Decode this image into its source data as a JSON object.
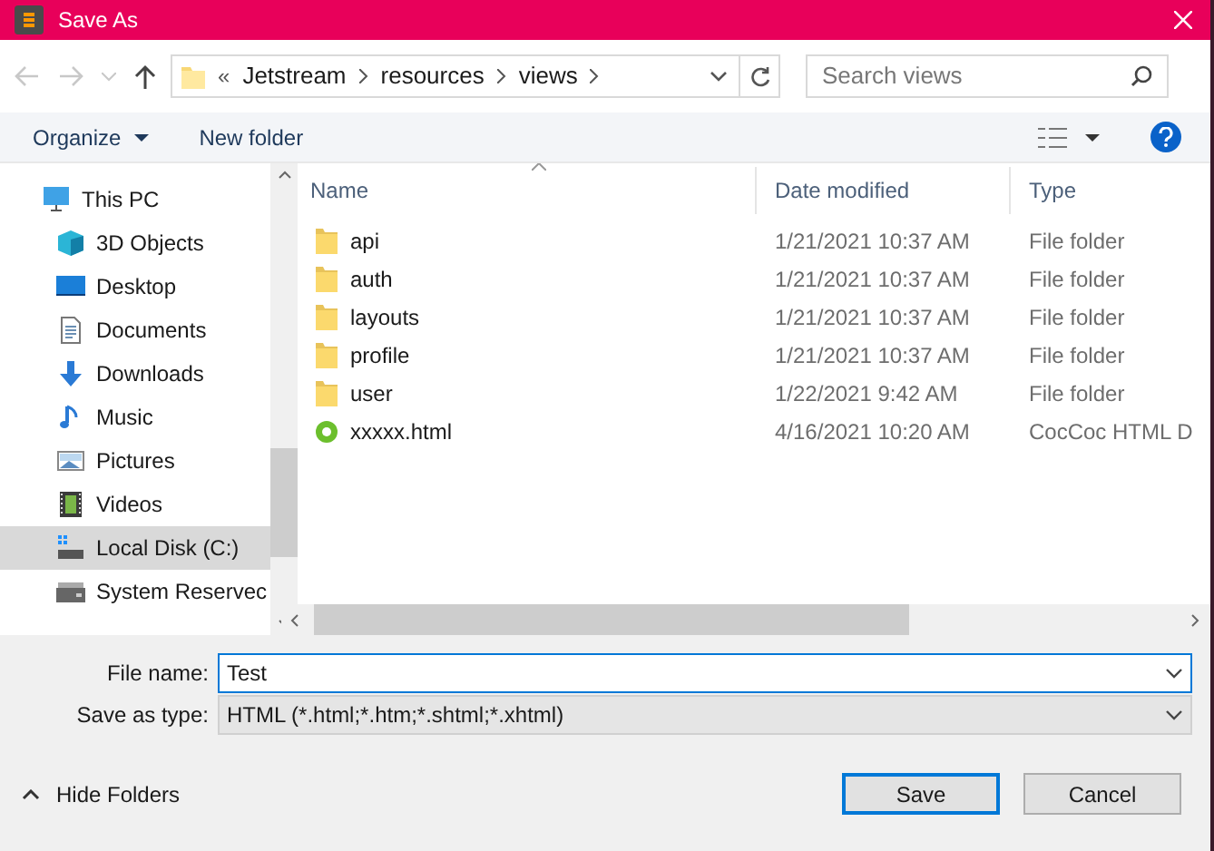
{
  "window": {
    "title": "Save As"
  },
  "address_bar": {
    "overflow": "«",
    "path": [
      "Jetstream",
      "resources",
      "views"
    ]
  },
  "search": {
    "placeholder": "Search views"
  },
  "toolbar": {
    "organize": "Organize",
    "new_folder": "New folder"
  },
  "sidebar": {
    "items": [
      {
        "label": "This PC",
        "kind": "pc",
        "selected": false,
        "children": [
          {
            "label": "3D Objects",
            "kind": "cube",
            "selected": false
          },
          {
            "label": "Desktop",
            "kind": "desktop",
            "selected": false
          },
          {
            "label": "Documents",
            "kind": "document",
            "selected": false
          },
          {
            "label": "Downloads",
            "kind": "download",
            "selected": false
          },
          {
            "label": "Music",
            "kind": "music",
            "selected": false
          },
          {
            "label": "Pictures",
            "kind": "pictures",
            "selected": false
          },
          {
            "label": "Videos",
            "kind": "videos",
            "selected": false
          },
          {
            "label": "Local Disk (C:)",
            "kind": "disk",
            "selected": true
          },
          {
            "label": "System Reservec",
            "kind": "drive",
            "selected": false
          }
        ]
      }
    ]
  },
  "table": {
    "columns": [
      "Name",
      "Date modified",
      "Type"
    ],
    "rows": [
      {
        "name": "api",
        "date": "1/21/2021 10:37 AM",
        "type": "File folder",
        "kind": "folder"
      },
      {
        "name": "auth",
        "date": "1/21/2021 10:37 AM",
        "type": "File folder",
        "kind": "folder"
      },
      {
        "name": "layouts",
        "date": "1/21/2021 10:37 AM",
        "type": "File folder",
        "kind": "folder"
      },
      {
        "name": "profile",
        "date": "1/21/2021 10:37 AM",
        "type": "File folder",
        "kind": "folder"
      },
      {
        "name": "user",
        "date": "1/22/2021 9:42 AM",
        "type": "File folder",
        "kind": "folder"
      },
      {
        "name": "xxxxx.html",
        "date": "4/16/2021 10:20 AM",
        "type": "CocCoc HTML D",
        "kind": "html"
      }
    ]
  },
  "file_name": {
    "label": "File name:",
    "value": "Test"
  },
  "save_as_type": {
    "label": "Save as type:",
    "value": "HTML (*.html;*.htm;*.shtml;*.xhtml)"
  },
  "hide_folders": "Hide Folders",
  "buttons": {
    "save": "Save",
    "cancel": "Cancel"
  }
}
